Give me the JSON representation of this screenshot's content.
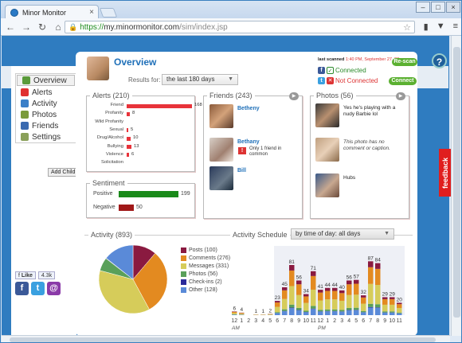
{
  "browser": {
    "tab_title": "Minor Monitor",
    "url_secure": "https://",
    "url_host": "my.minormonitor.com",
    "url_path": "/sim/index.jsp"
  },
  "sidebar": {
    "items": [
      {
        "label": "Overview",
        "icon": "home-icon",
        "color": "#5a9a3a",
        "active": true
      },
      {
        "label": "Alerts",
        "icon": "warning-icon",
        "color": "#e03030"
      },
      {
        "label": "Activity",
        "icon": "activity-icon",
        "color": "#3a7fc8"
      },
      {
        "label": "Photos",
        "icon": "photo-icon",
        "color": "#7a9a3a"
      },
      {
        "label": "Friends",
        "icon": "friends-icon",
        "color": "#3a6ab0"
      },
      {
        "label": "Settings",
        "icon": "gear-icon",
        "color": "#8aa05a"
      }
    ],
    "add_child": "Add Child",
    "like_label": "Like",
    "like_count": "4.3k"
  },
  "header": {
    "title": "Overview",
    "results_for_label": "Results for:",
    "range_select": "the last 180 days",
    "last_scanned_label": "last scanned",
    "last_scanned_value": "1:40 PM, September 27, 20",
    "rescan_button": "Re-scan",
    "facebook_status": "Connected",
    "twitter_status": "Not Connected",
    "connect_button": "Connect"
  },
  "alerts": {
    "title": "Alerts (210)",
    "rows": [
      {
        "label": "Friend",
        "value": 168,
        "width": 82
      },
      {
        "label": "Profanity",
        "value": 8,
        "width": 3
      },
      {
        "label": "Wild Profanity",
        "value": "",
        "width": 0
      },
      {
        "label": "Sexual",
        "value": 5,
        "width": 2
      },
      {
        "label": "Drug/Alcohol",
        "value": 10,
        "width": 4
      },
      {
        "label": "Bullying",
        "value": 13,
        "width": 5
      },
      {
        "label": "Violence",
        "value": 6,
        "width": 2
      },
      {
        "label": "Solicitation",
        "value": "",
        "width": 0
      }
    ]
  },
  "friends": {
    "title": "Friends (243)",
    "items": [
      {
        "name": "Betheny",
        "note": ""
      },
      {
        "name": "Bethany",
        "note": "Only 1 friend in common"
      },
      {
        "name": "Bill",
        "note": ""
      }
    ]
  },
  "photos": {
    "title": "Photos (56)",
    "items": [
      {
        "caption": "Yes he's playing with a nudy Barbie lol"
      },
      {
        "caption": "This photo has no comment or caption."
      },
      {
        "caption": "Hubs"
      }
    ]
  },
  "sentiment": {
    "title": "Sentiment",
    "positive_label": "Positive",
    "positive_value": 199,
    "negative_label": "Negative",
    "negative_value": 50,
    "positive_color": "#1a8a1a",
    "negative_color": "#a01818"
  },
  "activity": {
    "title": "Activity (893)",
    "schedule_title": "Activity Schedule",
    "schedule_select": "by time of day: all days",
    "legend": [
      {
        "label": "Posts (100)",
        "color": "#8a1a40"
      },
      {
        "label": "Comments (276)",
        "color": "#e38a20"
      },
      {
        "label": "Messages (331)",
        "color": "#d6cc5a"
      },
      {
        "label": "Photos (56)",
        "color": "#5aa05a"
      },
      {
        "label": "Check-ins (2)",
        "color": "#2a2a9a"
      },
      {
        "label": "Other (128)",
        "color": "#5a8ad8"
      }
    ]
  },
  "chart_data": [
    {
      "type": "pie",
      "title": "Activity (893)",
      "categories": [
        "Posts",
        "Comments",
        "Messages",
        "Photos",
        "Check-ins",
        "Other"
      ],
      "values": [
        100,
        276,
        331,
        56,
        2,
        128
      ],
      "colors": [
        "#8a1a40",
        "#e38a20",
        "#d6cc5a",
        "#5aa05a",
        "#2a2a9a",
        "#5a8ad8"
      ]
    },
    {
      "type": "bar",
      "title": "Activity Schedule",
      "categories": [
        "12",
        "1",
        "2",
        "3",
        "4",
        "5",
        "6",
        "7",
        "8",
        "9",
        "10",
        "11",
        "12",
        "1",
        "2",
        "3",
        "4",
        "5",
        "6",
        "7",
        "8",
        "9",
        "10",
        "11"
      ],
      "period_labels": [
        "AM",
        "PM"
      ],
      "values": [
        6,
        4,
        0,
        1,
        1,
        2,
        23,
        45,
        81,
        56,
        34,
        71,
        41,
        44,
        44,
        40,
        56,
        57,
        32,
        87,
        84,
        29,
        29,
        20
      ],
      "ylim": [
        0,
        90
      ]
    }
  ],
  "feedback_label": "feedback",
  "help_label": "?"
}
